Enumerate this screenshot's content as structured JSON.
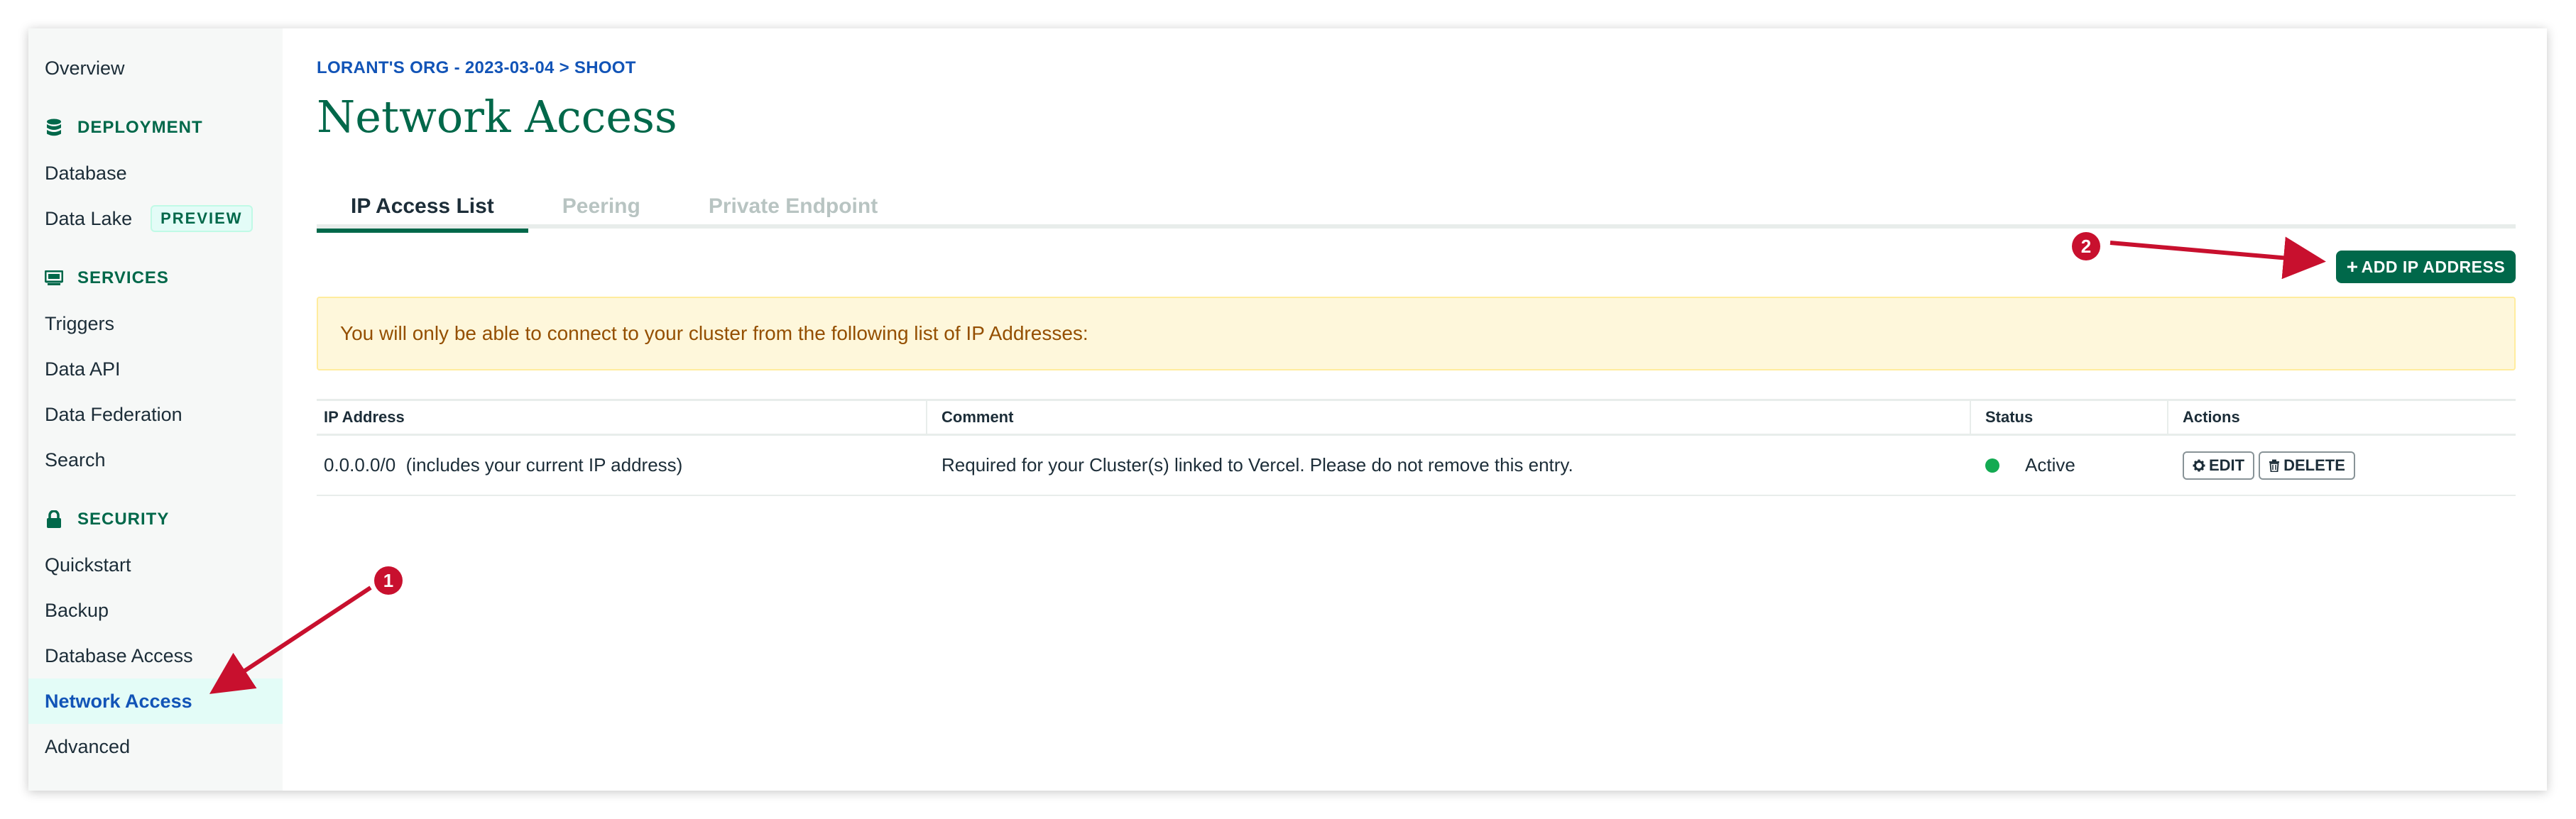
{
  "sidebar": {
    "overview": "Overview",
    "deployment": {
      "title": "DEPLOYMENT",
      "icon": "database-icon",
      "items": [
        "Database",
        "Data Lake"
      ],
      "data_lake_badge": "PREVIEW"
    },
    "services": {
      "title": "SERVICES",
      "icon": "monitor-icon",
      "items": [
        "Triggers",
        "Data API",
        "Data Federation",
        "Search"
      ]
    },
    "security": {
      "title": "SECURITY",
      "icon": "lock-icon",
      "items": [
        "Quickstart",
        "Backup",
        "Database Access",
        "Network Access",
        "Advanced"
      ],
      "active": "Network Access"
    }
  },
  "header": {
    "breadcrumb": "LORANT'S ORG - 2023-03-04 > SHOOT",
    "title": "Network Access"
  },
  "tabs": [
    {
      "label": "IP Access List",
      "active": true
    },
    {
      "label": "Peering",
      "active": false
    },
    {
      "label": "Private Endpoint",
      "active": false
    }
  ],
  "add_button": {
    "label": "ADD IP ADDRESS",
    "icon": "plus-icon"
  },
  "banner": {
    "text": "You will only be able to connect to your cluster from the following list of IP Addresses:"
  },
  "table": {
    "columns": [
      "IP Address",
      "Comment",
      "Status",
      "Actions"
    ],
    "rows": [
      {
        "ip": "0.0.0.0/0  (includes your current IP address)",
        "comment": "Required for your Cluster(s) linked to Vercel. Please do not remove this entry.",
        "status": "Active",
        "edit": "EDIT",
        "delete": "DELETE"
      }
    ]
  },
  "annotations": [
    "1",
    "2"
  ],
  "colors": {
    "accent": "#00684a",
    "link": "#1254b7",
    "annotation": "#c8102e",
    "status_active": "#13aa52",
    "banner_bg": "#fef7db"
  }
}
